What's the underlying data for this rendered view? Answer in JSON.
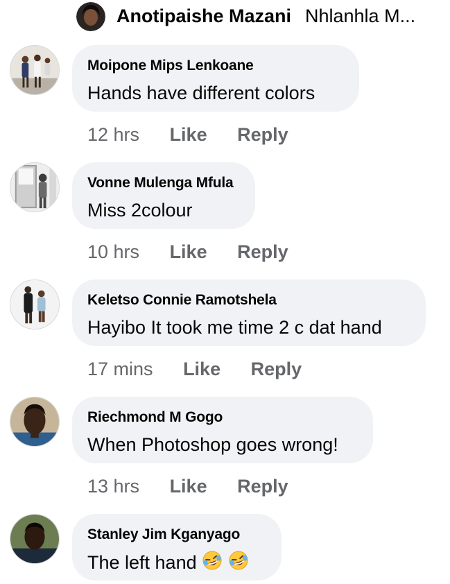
{
  "header": {
    "name": "Anotipaishe Mazani",
    "subtitle": "Nhlanhla M..."
  },
  "comments": [
    {
      "author": "Moipone Mips Lenkoane",
      "text": "Hands have different  colors",
      "time": "12 hrs",
      "like": "Like",
      "reply": "Reply"
    },
    {
      "author": "Vonne Mulenga Mfula",
      "text": "Miss 2colour",
      "time": "10 hrs",
      "like": "Like",
      "reply": "Reply"
    },
    {
      "author": "Keletso Connie Ramotshela",
      "text": "Hayibo It took me time 2 c dat hand",
      "time": "17 mins",
      "like": "Like",
      "reply": "Reply"
    },
    {
      "author": "Riechmond M Gogo",
      "text": "When Photoshop goes wrong!",
      "time": "13 hrs",
      "like": "Like",
      "reply": "Reply"
    },
    {
      "author": "Stanley Jim Kganyago",
      "text": "The left hand",
      "time": "",
      "like": "",
      "reply": "",
      "emojis": [
        "rolling-on-floor-laughing-emoji",
        "rolling-on-floor-laughing-emoji"
      ]
    }
  ]
}
